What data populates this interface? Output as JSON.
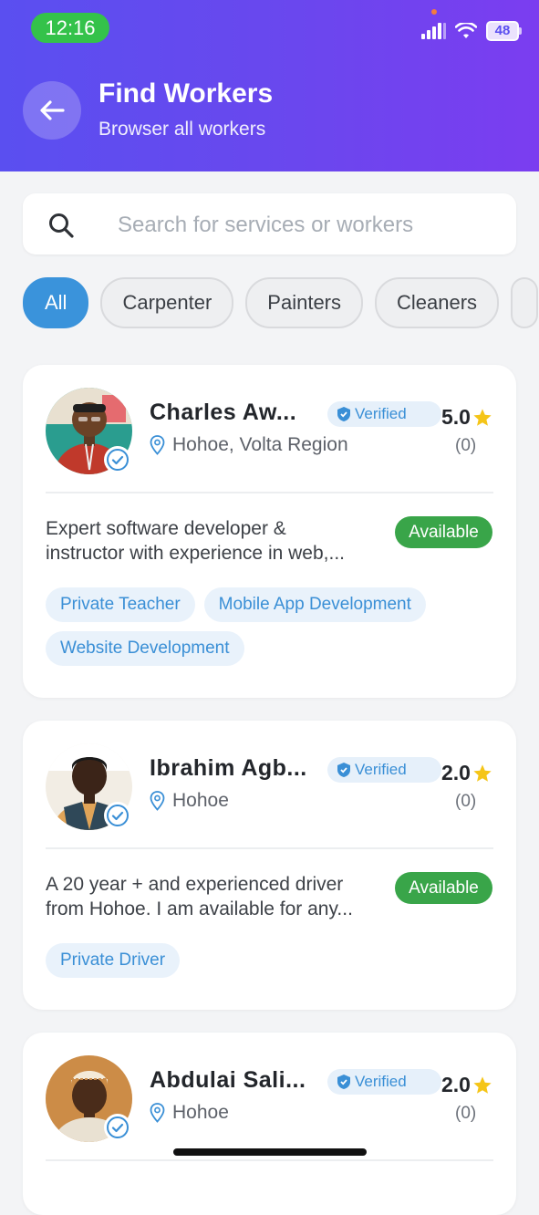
{
  "status_bar": {
    "time": "12:16",
    "battery": "48"
  },
  "header": {
    "title": "Find Workers",
    "subtitle": "Browser all workers"
  },
  "search": {
    "placeholder": "Search for services or workers"
  },
  "categories": [
    "All",
    "Carpenter",
    "Painters",
    "Cleaners"
  ],
  "selected_category": "All",
  "verified_label": "Verified",
  "workers": [
    {
      "name": "Charles  Aw...",
      "location": "Hohoe, Volta Region",
      "rating": "5.0",
      "reviews": "(0)",
      "description_line1": "Expert software developer &",
      "description_line2": "instructor with experience in web,...",
      "status": "Available",
      "skills": [
        "Private Teacher",
        "Mobile App Development",
        "Website Development"
      ]
    },
    {
      "name": "Ibrahim  Agb...",
      "location": "Hohoe",
      "rating": "2.0",
      "reviews": "(0)",
      "description_line1": "A 20 year + and experienced driver",
      "description_line2": "from Hohoe. I am available for any...",
      "status": "Available",
      "skills": [
        "Private Driver"
      ]
    },
    {
      "name": "Abdulai  Sali...",
      "location": "Hohoe",
      "rating": "2.0",
      "reviews": "(0)"
    }
  ],
  "colors": {
    "header_gradient_start": "#5a4ff0",
    "header_gradient_end": "#7b3df0",
    "accent_blue": "#3a93db",
    "available_green": "#39a549",
    "star": "#f5c518"
  }
}
